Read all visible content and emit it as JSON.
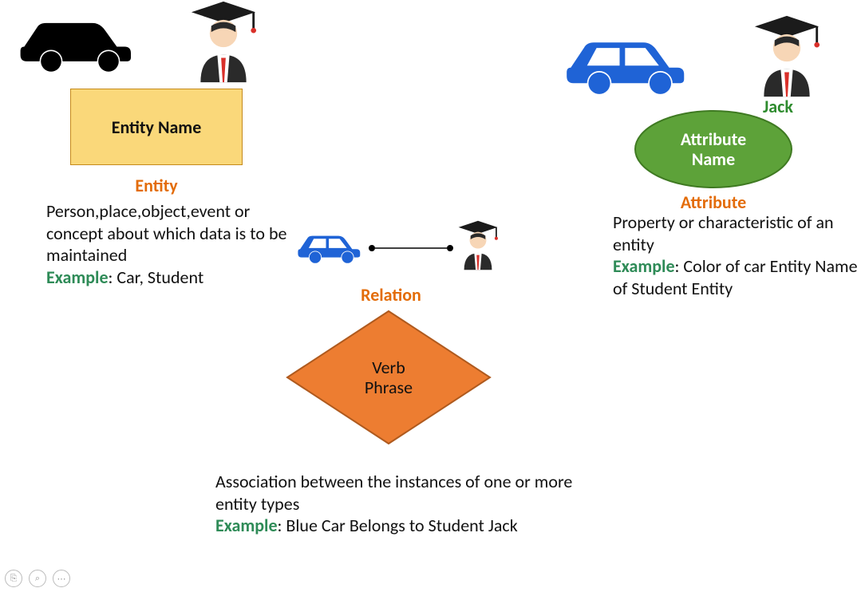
{
  "entity": {
    "shape_label": "Entity Name",
    "title": "Entity",
    "desc": "Person,place,object,event or concept about which data is to be maintained",
    "example_label": "Example",
    "example_text": ": Car, Student"
  },
  "relation": {
    "shape_label_l1": "Verb",
    "shape_label_l2": "Phrase",
    "title": "Relation",
    "desc": "Association between the instances of one or more entity types",
    "example_label": "Example",
    "example_text": ": Blue Car Belongs to Student Jack"
  },
  "attribute": {
    "student_name": "Jack",
    "shape_label_l1": "Attribute",
    "shape_label_l2": "Name",
    "title": "Attribute",
    "desc": "Property or characteristic of an entity",
    "example_label": "Example",
    "example_text": ": Color of car Entity Name of Student Entity"
  },
  "toolbar": {
    "copy": "⎘",
    "zoom": "⌕",
    "more": "⋯"
  }
}
